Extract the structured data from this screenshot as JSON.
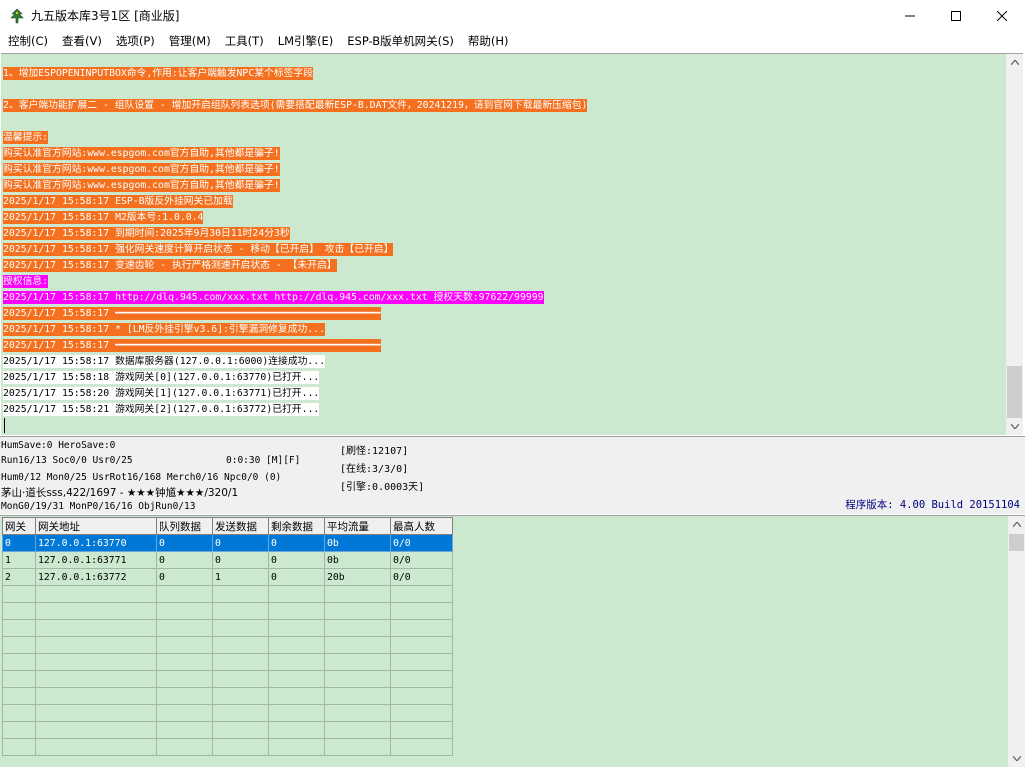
{
  "window": {
    "title": "九五版本库3号1区 [商业版]",
    "icon": "tree-app-icon"
  },
  "menu": [
    "控制(C)",
    "查看(V)",
    "选项(P)",
    "管理(M)",
    "工具(T)",
    "LM引擎(E)",
    "ESP-B版单机网关(S)",
    "帮助(H)"
  ],
  "log": {
    "lines_top": [
      "1、增加ESPOPENINPUTBOX命令,作用:让客户端触发NPC某个标签字段",
      "2、客户端功能扩展二 - 组队设置 - 增加开启组队列表选项(需要搭配最新ESP-B.DAT文件，20241219，请到官网下载最新压缩包)"
    ],
    "lines": [
      {
        "text": "温馨提示:",
        "style": "orange"
      },
      {
        "text": "购买认准官方网站:www.espgom.com官方自助,其他都是骗子!",
        "style": "orange"
      },
      {
        "text": "购买认准官方网站:www.espgom.com官方自助,其他都是骗子!",
        "style": "orange"
      },
      {
        "text": "购买认准官方网站:www.espgom.com官方自助,其他都是骗子!",
        "style": "orange"
      },
      {
        "text": "2025/1/17 15:58:17 ESP-B版反外挂网关已加载",
        "style": "orange"
      },
      {
        "text": "2025/1/17 15:58:17 M2版本号:1.0.0.4",
        "style": "orange"
      },
      {
        "text": "2025/1/17 15:58:17 到期时间:2025年9月30日11时24分3秒",
        "style": "orange"
      },
      {
        "text": "2025/1/17 15:58:17 强化网关速度计算开启状态 - 移动【已开启】 攻击【已开启】",
        "style": "orange"
      },
      {
        "text": "2025/1/17 15:58:17 变速齿轮 - 执行严格测速开启状态 - 【未开启】",
        "style": "orange"
      },
      {
        "text": "授权信息:",
        "style": "magenta"
      },
      {
        "text": "2025/1/17 15:58:17 http://dlq.945.com/xxx.txt http://dlq.945.com/xxx.txt 授权天数:97622/99999",
        "style": "magenta"
      },
      {
        "text": "2025/1/17 15:58:17 ━━━━━━━━━━━━━━━━━━━━━━━━━━━━━━━━━━━━━━━━━━━━━",
        "style": "orange"
      },
      {
        "text": "2025/1/17 15:58:17 * [LM反外挂引擎v3.6]:引擎漏洞修复成功...",
        "style": "orange"
      },
      {
        "text": "2025/1/17 15:58:17 ━━━━━━━━━━━━━━━━━━━━━━━━━━━━━━━━━━━━━━━━━━━━━",
        "style": "orange"
      },
      {
        "text": "2025/1/17 15:58:17 数据库服务器(127.0.0.1:6000)连接成功...",
        "style": "white"
      },
      {
        "text": "2025/1/17 15:58:18 游戏网关[0](127.0.0.1:63770)已打开...",
        "style": "white"
      },
      {
        "text": "2025/1/17 15:58:20 游戏网关[1](127.0.0.1:63771)已打开...",
        "style": "white"
      },
      {
        "text": "2025/1/17 15:58:21 游戏网关[2](127.0.0.1:63772)已打开...",
        "style": "white"
      }
    ]
  },
  "status": {
    "line1": "HumSave:0 HeroSave:0",
    "line2": "Run16/13 Soc0/0 Usr0/25",
    "time": "0:0:30 [M][F]",
    "line3": "Hum0/12 Mon0/25 UsrRot16/168 Merch0/16 Npc0/0 (0)",
    "line4": "茅山·道长sss,422/1697 - ★★★钟馗★★★/320/1",
    "line5": "MonG0/19/31 MonP0/16/16 ObjRun0/13",
    "refresh": "[刷怪:12107]",
    "online": "[在线:3/3/0]",
    "engine": "[引擎:0.0003天]",
    "version": "程序版本: 4.00 Build 20151104"
  },
  "grid": {
    "headers": [
      "网关",
      "网关地址",
      "队列数据",
      "发送数据",
      "剩余数据",
      "平均流量",
      "最高人数"
    ],
    "rows": [
      [
        "0",
        "127.0.0.1:63770",
        "0",
        "0",
        "0",
        "0b",
        "0/0"
      ],
      [
        "1",
        "127.0.0.1:63771",
        "0",
        "0",
        "0",
        "0b",
        "0/0"
      ],
      [
        "2",
        "127.0.0.1:63772",
        "0",
        "1",
        "0",
        "20b",
        "0/0"
      ]
    ],
    "selected_row": 0,
    "empty_rows": 10
  },
  "colors": {
    "log_bg": "#cce8cf",
    "orange": "#f4701f",
    "magenta": "#ff00ff",
    "selection": "#0078d7",
    "version_text": "#00007f"
  }
}
